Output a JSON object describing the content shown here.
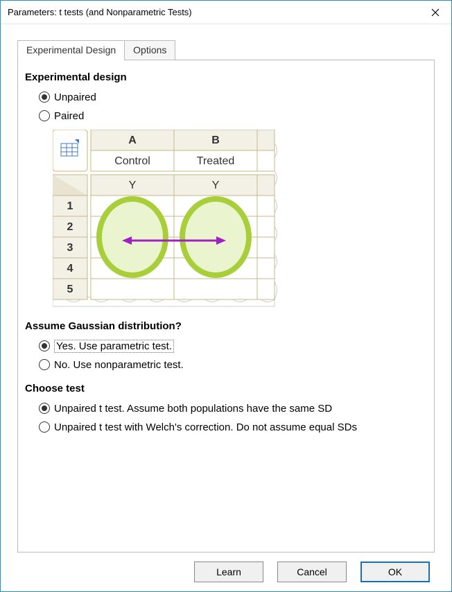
{
  "window": {
    "title": "Parameters: t tests (and Nonparametric Tests)"
  },
  "tabs": {
    "design": "Experimental Design",
    "options": "Options"
  },
  "design": {
    "heading": "Experimental design",
    "unpaired": "Unpaired",
    "paired": "Paired"
  },
  "illus": {
    "colA": "A",
    "colB": "B",
    "groupA": "Control",
    "groupB": "Treated",
    "subA": "Y",
    "subB": "Y",
    "rows": [
      "1",
      "2",
      "3",
      "4",
      "5"
    ]
  },
  "gaussian": {
    "heading": "Assume Gaussian distribution?",
    "yes": "Yes. Use parametric test.",
    "no": "No. Use nonparametric test."
  },
  "choose": {
    "heading": "Choose test",
    "opt1": "Unpaired t test. Assume both populations have the same SD",
    "opt2": "Unpaired t test with Welch's correction. Do not assume equal SDs"
  },
  "buttons": {
    "learn": "Learn",
    "cancel": "Cancel",
    "ok": "OK"
  }
}
